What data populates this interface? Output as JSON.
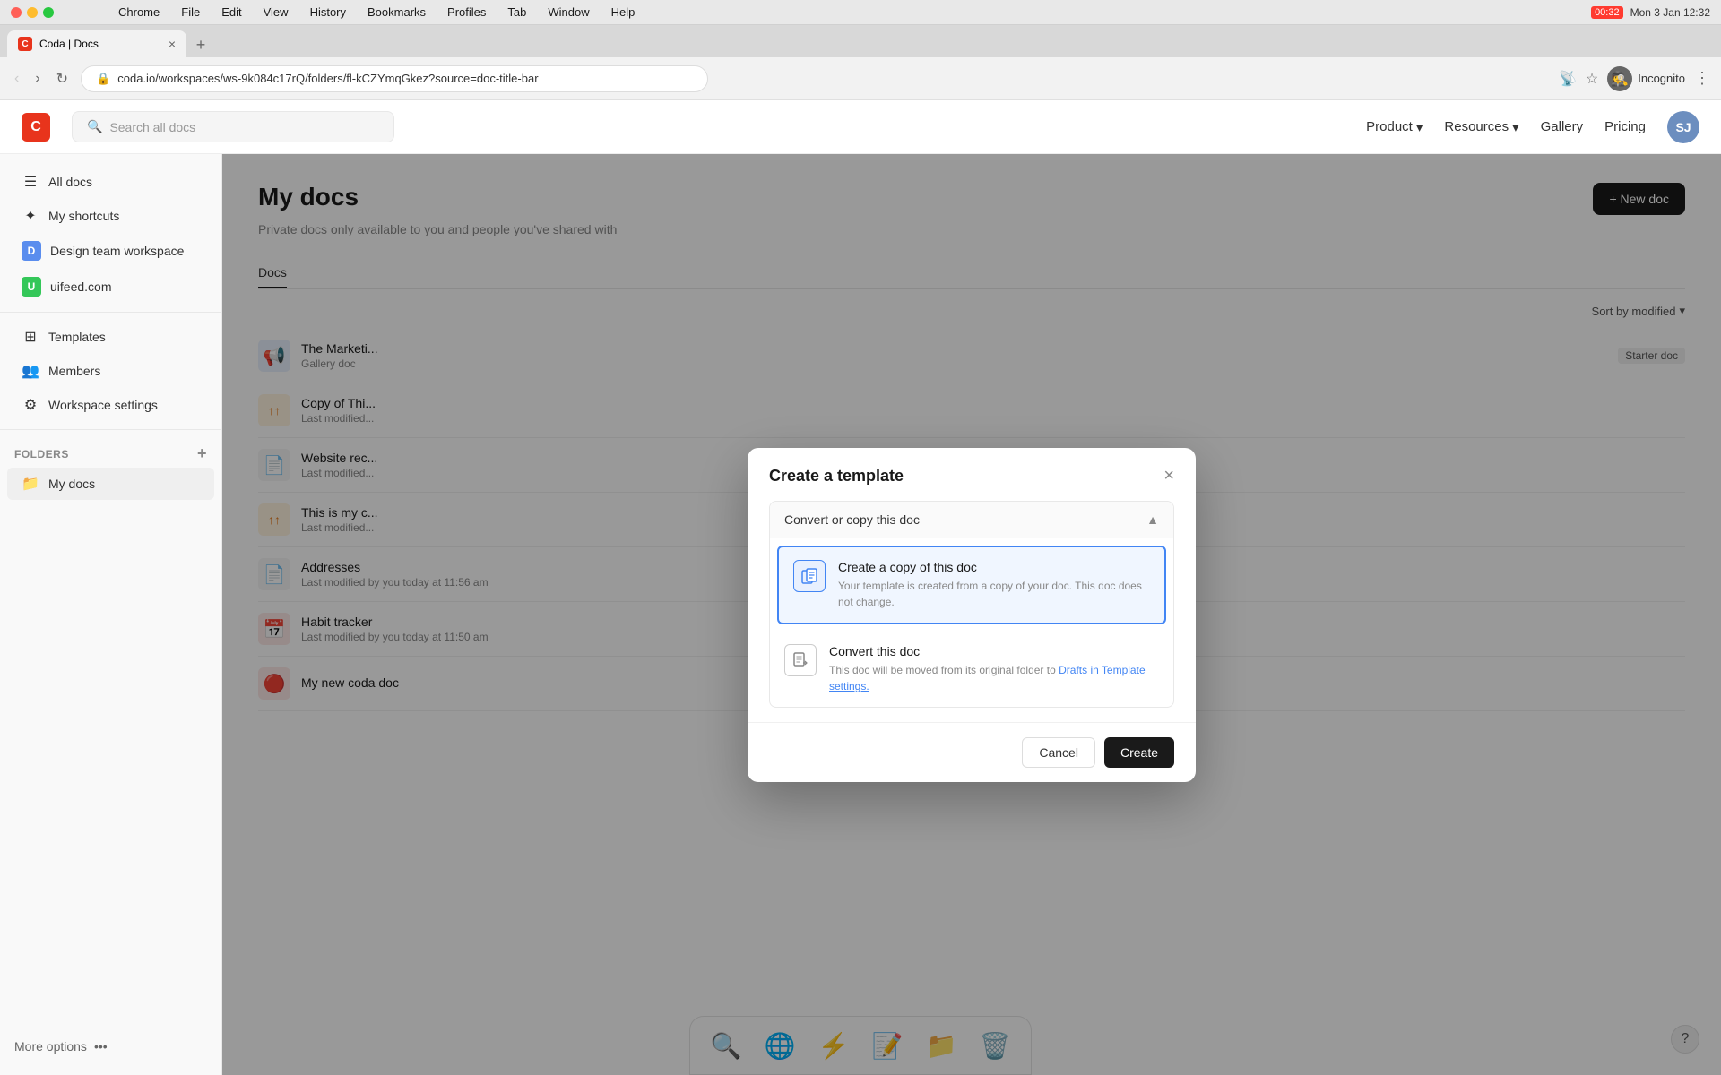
{
  "os": {
    "time": "Mon 3 Jan  12:32",
    "battery": "00:32",
    "menus": [
      "Chrome",
      "File",
      "Edit",
      "View",
      "History",
      "Bookmarks",
      "Profiles",
      "Tab",
      "Window",
      "Help"
    ]
  },
  "browser": {
    "tab_title": "Coda | Docs",
    "tab_favicon": "C",
    "address": "coda.io/workspaces/ws-9k084c17rQ/folders/fl-kCZYmqGkez?source=doc-title-bar",
    "incognito_label": "Incognito"
  },
  "coda_nav": {
    "logo": "C",
    "search_placeholder": "Search all docs",
    "product_label": "Product",
    "resources_label": "Resources",
    "gallery_label": "Gallery",
    "pricing_label": "Pricing",
    "avatar_initials": "SJ"
  },
  "sidebar": {
    "all_docs": "All docs",
    "my_shortcuts": "My shortcuts",
    "design_team": "Design team workspace",
    "uifeed": "uifeed.com",
    "templates": "Templates",
    "members": "Members",
    "workspace_settings": "Workspace settings",
    "folders_label": "FOLDERS",
    "my_docs_folder": "My docs",
    "more_options": "More options"
  },
  "content": {
    "title": "My docs",
    "subtitle": "Private docs only available to you and people you've shared with",
    "new_doc_label": "+ New doc",
    "tab_docs": "Docs",
    "sort_by": "Sort by modified",
    "docs": [
      {
        "name": "The Marketi...",
        "meta": "Gallery doc",
        "icon": "📢",
        "icon_type": "blue",
        "badge": "Starter doc"
      },
      {
        "name": "Copy of Thi...",
        "meta": "Last modified...",
        "icon": "↑↑",
        "icon_type": "orange",
        "badge": ""
      },
      {
        "name": "Website rec...",
        "meta": "Last modified...",
        "icon": "📄",
        "icon_type": "default",
        "badge": ""
      },
      {
        "name": "This is my c...",
        "meta": "Last modified...",
        "icon": "↑↑",
        "icon_type": "orange",
        "badge": ""
      },
      {
        "name": "Addresses",
        "meta": "Last modified by you today at 11:56 am",
        "icon": "📄",
        "icon_type": "default",
        "badge": ""
      },
      {
        "name": "Habit tracker",
        "meta": "Last modified by you today at 11:50 am",
        "icon": "📅",
        "icon_type": "red",
        "badge": ""
      },
      {
        "name": "My new coda doc",
        "meta": "",
        "icon": "🔴",
        "icon_type": "red",
        "badge": ""
      }
    ]
  },
  "modal": {
    "title": "Create a template",
    "close_label": "×",
    "section_title": "Convert or copy this doc",
    "option1_title": "Create a copy of this doc",
    "option1_desc": "Your template is created from a copy of your doc. This doc does not change.",
    "option2_title": "Convert this doc",
    "option2_desc": "This doc will be moved from its original folder to",
    "option2_link": "Drafts in Template settings.",
    "cancel_label": "Cancel",
    "create_label": "Create"
  },
  "dock": {
    "icons": [
      "🔍",
      "📁",
      "🌐",
      "⚡",
      "📝",
      "🗑️"
    ]
  }
}
